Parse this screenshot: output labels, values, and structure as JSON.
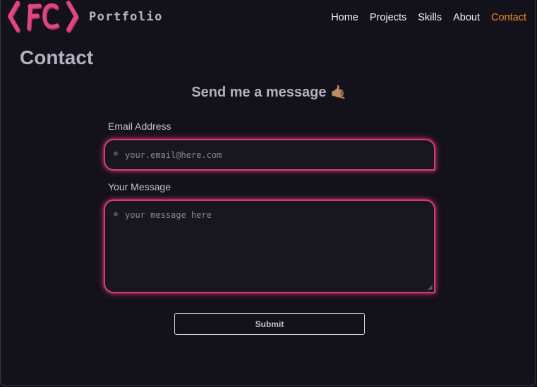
{
  "header": {
    "logo_text": "{FC}",
    "brand": "Portfolio",
    "nav": [
      {
        "label": "Home"
      },
      {
        "label": "Projects"
      },
      {
        "label": "Skills"
      },
      {
        "label": "About"
      },
      {
        "label": "Contact",
        "active": true
      }
    ]
  },
  "page": {
    "title": "Contact"
  },
  "form": {
    "heading": "Send me a message",
    "heading_emoji": "🤙🏽",
    "email": {
      "label": "Email Address",
      "placeholder": "your.email@here.com",
      "value": ""
    },
    "message": {
      "label": "Your Message",
      "placeholder": "your message here",
      "value": ""
    },
    "field_icon": "⊚",
    "submit_label": "Submit"
  },
  "colors": {
    "background": "#131119",
    "accent_nav_active": "#f08a24",
    "field_border_glow": "#d83a7c",
    "logo": "#e0467f",
    "text_muted": "#b3b0c0"
  },
  "icons": {
    "logo": "fc-logo-icon",
    "field_prefix": "circle-dot-icon",
    "resize": "resize-handle-icon"
  }
}
